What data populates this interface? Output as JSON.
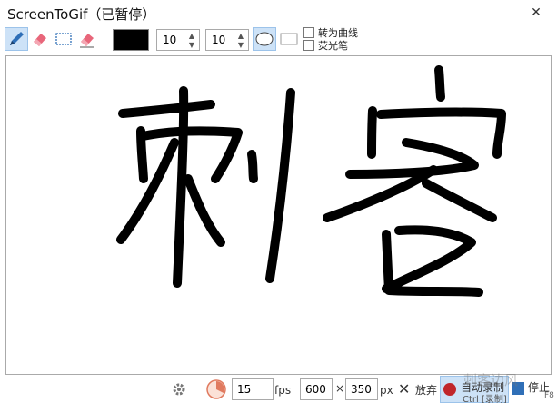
{
  "window": {
    "title": "ScreenToGif（已暂停）",
    "close_glyph": "✕"
  },
  "toolbar": {
    "pen_icon": "pen-icon",
    "eraser_icon": "eraser-icon",
    "select_icon": "rect-select-icon",
    "erase_all_icon": "eraser-alt-icon",
    "color": "#000000",
    "width_value": "10",
    "height_value": "10",
    "ellipse_tip": "ellipse-tip-icon",
    "rect_tip": "rectangle-tip-icon",
    "fit_to_curve_label": "转为曲线",
    "highlighter_label": "荧光笔",
    "accent": "#cde2f7"
  },
  "bottom": {
    "settings_icon": "gear-icon",
    "fps_value": "15",
    "fps_label": "fps",
    "width_value": "600",
    "times": "×",
    "height_value": "350",
    "px_label": "px",
    "discard_label": "放弃",
    "record_label": "自动录制",
    "record_shortcut": "Ctrl [录制]",
    "stop_label": "停止",
    "stop_shortcut": "F8",
    "record_color": "#c0262b",
    "stop_color": "#2f6fb7"
  },
  "watermark": "刺客边风"
}
